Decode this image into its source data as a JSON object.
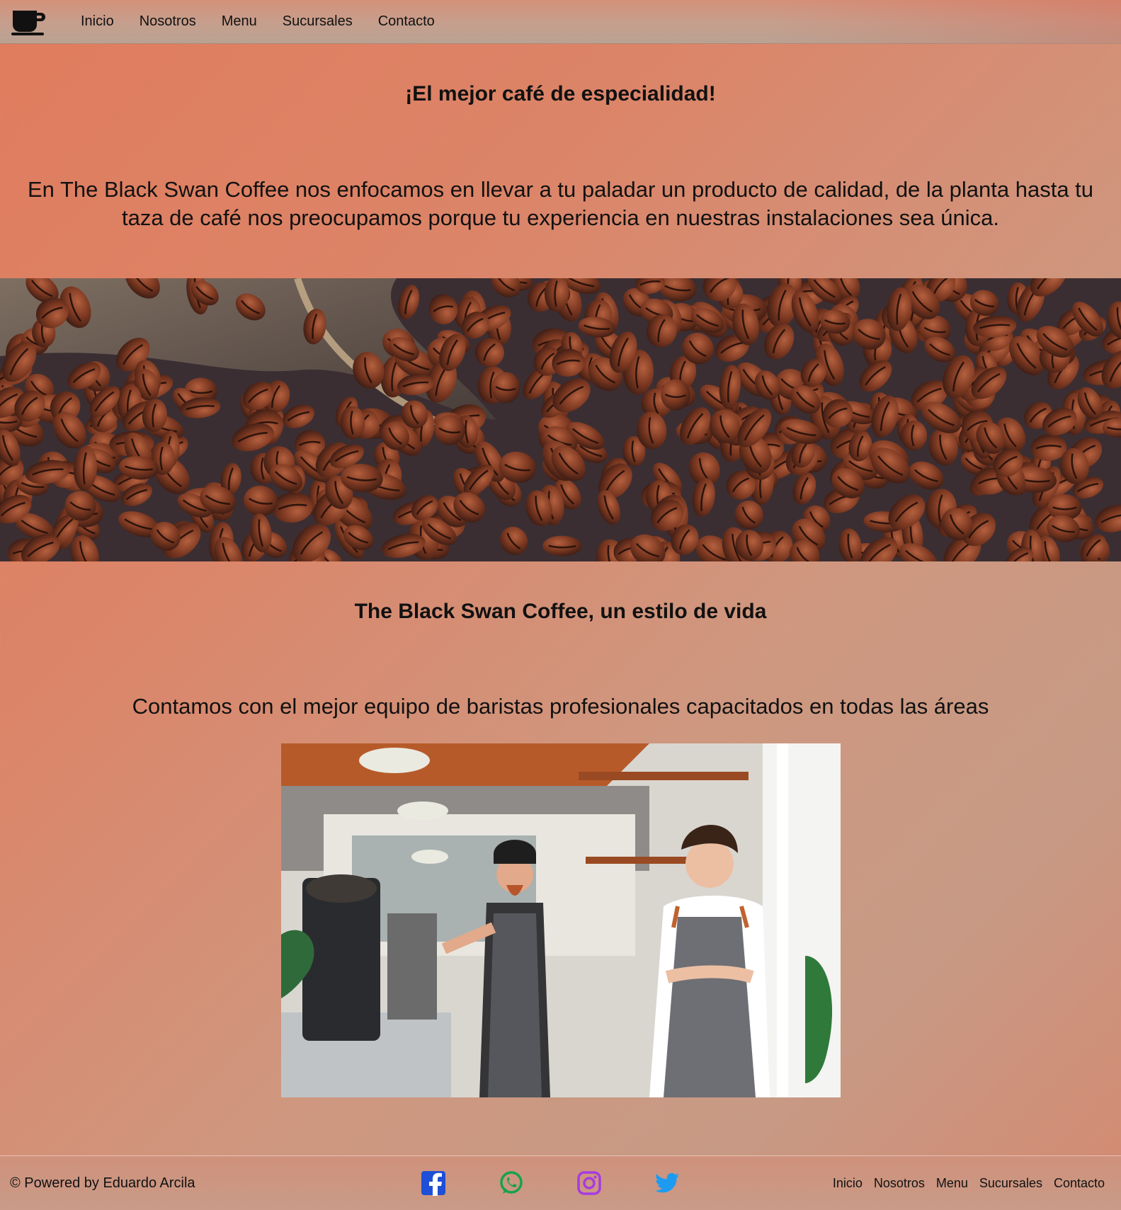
{
  "nav": {
    "logo_icon": "coffee-cup-icon",
    "items": [
      "Inicio",
      "Nosotros",
      "Menu",
      "Sucursales",
      "Contacto"
    ]
  },
  "hero": {
    "title": "¡El mejor café de especialidad!",
    "intro": "En The Black Swan Coffee nos enfocamos en llevar a tu paladar un producto de calidad, de la planta hasta tu taza de café nos preocupamos porque tu experiencia en nuestras instalaciones sea única."
  },
  "lifestyle": {
    "title": "The Black Swan Coffee, un estilo de vida",
    "team_text": "Contamos con el mejor equipo de baristas profesionales capacitados en todas las áreas"
  },
  "footer": {
    "copyright": "© Powered by Eduardo Arcila",
    "social_icons": [
      "facebook-icon",
      "whatsapp-icon",
      "instagram-icon",
      "twitter-icon"
    ],
    "social_colors": {
      "facebook": "#1f4fd6",
      "whatsapp": "#16a34a",
      "instagram": "#a73be0",
      "twitter": "#1d9bf0"
    },
    "links": [
      "Inicio",
      "Nosotros",
      "Menu",
      "Sucursales",
      "Contacto"
    ]
  }
}
